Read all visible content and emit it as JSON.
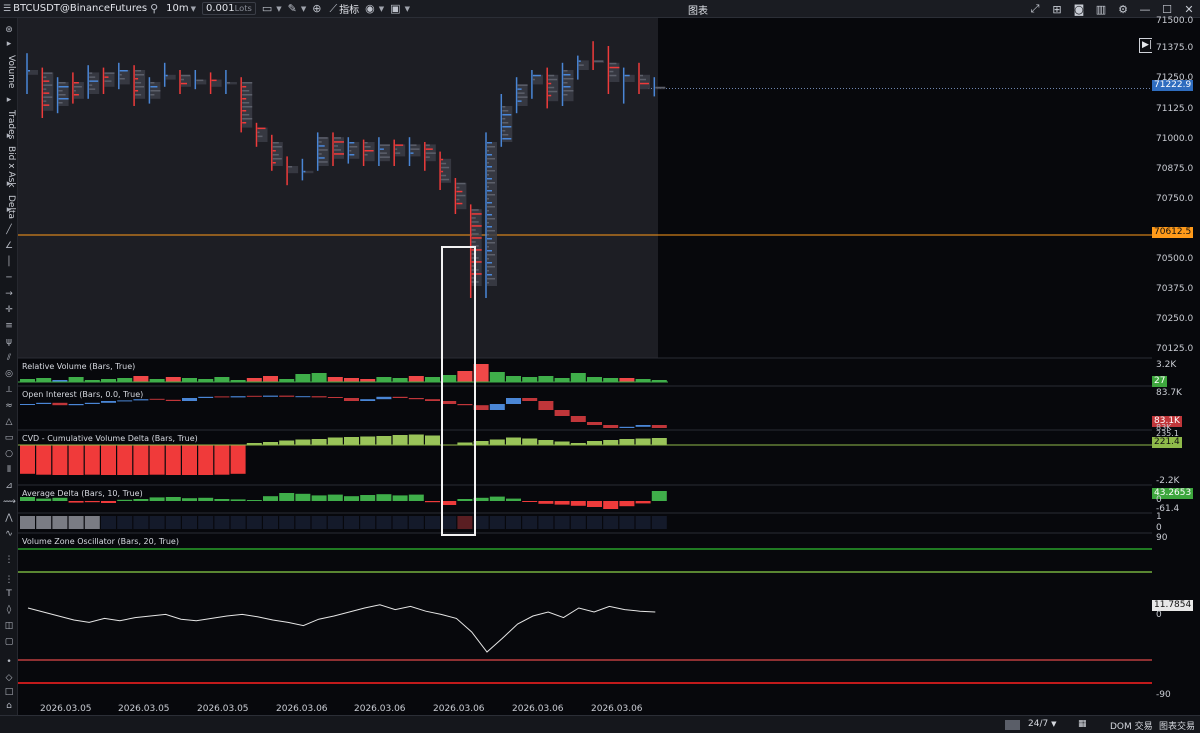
{
  "toolbar": {
    "symbol": "BTCUSDT@BinanceFutures",
    "interval": "10m",
    "lots_value": "0.001",
    "lots_unit": "Lots",
    "indicators_label": "指标",
    "window_title": "图表"
  },
  "left_tabs": [
    "Volume",
    "Trades",
    "Bid x Ask",
    "Delta"
  ],
  "price_axis": {
    "ticks": [
      "71500.0",
      "71375.0",
      "71250.0",
      "71125.0",
      "71000.0",
      "70875.0",
      "70750.0",
      "70625.0",
      "70500.0",
      "70375.0",
      "70250.0",
      "70125.0"
    ],
    "last_price": "71222.9",
    "line_price": "70612.5",
    "line_color": "#ff9a1a"
  },
  "panels": {
    "relative_volume": {
      "title": "Relative Volume (Bars, True)",
      "scale_top": "3.2K",
      "value": "27"
    },
    "open_interest": {
      "title": "Open Interest (Bars, 0.0, True)",
      "scale_top": "83.7K",
      "value": "83.1K",
      "scale_low": "83K"
    },
    "cvd": {
      "title": "CVD - Cumulative Volume Delta (Bars, True)",
      "value": "221.4",
      "value2": "235.1",
      "scale_low": "-2.2K"
    },
    "avg_delta": {
      "title": "Average Delta (Bars, 10, True)",
      "value": "43.2653",
      "scale_mid": "0",
      "scale_low": "-61.4"
    },
    "extra_scale": [
      "1",
      "0"
    ],
    "vzo": {
      "title": "Volume Zone Oscillator (Bars, 20, True)",
      "scale_top": "90",
      "value": "11.7854",
      "scale_mid": "0",
      "scale_low": "-90"
    }
  },
  "dates": [
    "2026.03.05",
    "2026.03.05",
    "2026.03.05",
    "2026.03.06",
    "2026.03.06",
    "2026.03.06",
    "2026.03.06",
    "2026.03.06"
  ],
  "bottom_bar": {
    "session": "24/7",
    "dom": "DOM 交易",
    "chart_trade": "图表交易"
  },
  "chart_data": {
    "type": "line",
    "candles": [
      {
        "o": 71300,
        "h": 71370,
        "l": 71200,
        "c": 71280,
        "dir": "up"
      },
      {
        "o": 71290,
        "h": 71310,
        "l": 71100,
        "c": 71130,
        "dir": "down"
      },
      {
        "o": 71150,
        "h": 71270,
        "l": 71120,
        "c": 71250,
        "dir": "up"
      },
      {
        "o": 71250,
        "h": 71290,
        "l": 71160,
        "c": 71180,
        "dir": "down"
      },
      {
        "o": 71200,
        "h": 71320,
        "l": 71180,
        "c": 71290,
        "dir": "up"
      },
      {
        "o": 71290,
        "h": 71310,
        "l": 71200,
        "c": 71230,
        "dir": "down"
      },
      {
        "o": 71240,
        "h": 71330,
        "l": 71220,
        "c": 71300,
        "dir": "up"
      },
      {
        "o": 71300,
        "h": 71320,
        "l": 71150,
        "c": 71180,
        "dir": "down"
      },
      {
        "o": 71180,
        "h": 71270,
        "l": 71160,
        "c": 71250,
        "dir": "up"
      },
      {
        "o": 71260,
        "h": 71330,
        "l": 71230,
        "c": 71280,
        "dir": "up"
      },
      {
        "o": 71280,
        "h": 71300,
        "l": 71200,
        "c": 71230,
        "dir": "down"
      },
      {
        "o": 71240,
        "h": 71300,
        "l": 71220,
        "c": 71260,
        "dir": "up"
      },
      {
        "o": 71260,
        "h": 71290,
        "l": 71200,
        "c": 71230,
        "dir": "down"
      },
      {
        "o": 71240,
        "h": 71300,
        "l": 71200,
        "c": 71250,
        "dir": "up"
      },
      {
        "o": 71250,
        "h": 71270,
        "l": 71040,
        "c": 71060,
        "dir": "down"
      },
      {
        "o": 71060,
        "h": 71080,
        "l": 70980,
        "c": 71000,
        "dir": "down"
      },
      {
        "o": 71000,
        "h": 71030,
        "l": 70880,
        "c": 70900,
        "dir": "down"
      },
      {
        "o": 70900,
        "h": 70940,
        "l": 70820,
        "c": 70870,
        "dir": "down"
      },
      {
        "o": 70870,
        "h": 70930,
        "l": 70840,
        "c": 70880,
        "dir": "up"
      },
      {
        "o": 70900,
        "h": 71040,
        "l": 70880,
        "c": 71020,
        "dir": "up"
      },
      {
        "o": 71020,
        "h": 71040,
        "l": 70900,
        "c": 70930,
        "dir": "down"
      },
      {
        "o": 70930,
        "h": 71020,
        "l": 70910,
        "c": 71000,
        "dir": "up"
      },
      {
        "o": 71000,
        "h": 71010,
        "l": 70900,
        "c": 70920,
        "dir": "down"
      },
      {
        "o": 70920,
        "h": 71020,
        "l": 70900,
        "c": 70990,
        "dir": "up"
      },
      {
        "o": 70990,
        "h": 71010,
        "l": 70900,
        "c": 70940,
        "dir": "down"
      },
      {
        "o": 70940,
        "h": 71020,
        "l": 70900,
        "c": 70990,
        "dir": "up"
      },
      {
        "o": 70990,
        "h": 71000,
        "l": 70880,
        "c": 70920,
        "dir": "down"
      },
      {
        "o": 70930,
        "h": 70960,
        "l": 70800,
        "c": 70830,
        "dir": "down"
      },
      {
        "o": 70830,
        "h": 70850,
        "l": 70700,
        "c": 70720,
        "dir": "down"
      },
      {
        "o": 70720,
        "h": 70740,
        "l": 70350,
        "c": 70400,
        "dir": "down"
      },
      {
        "o": 70400,
        "h": 71040,
        "l": 70350,
        "c": 71000,
        "dir": "up"
      },
      {
        "o": 71000,
        "h": 71200,
        "l": 70980,
        "c": 71150,
        "dir": "up"
      },
      {
        "o": 71150,
        "h": 71270,
        "l": 71120,
        "c": 71240,
        "dir": "up"
      },
      {
        "o": 71240,
        "h": 71300,
        "l": 71180,
        "c": 71280,
        "dir": "up"
      },
      {
        "o": 71280,
        "h": 71310,
        "l": 71140,
        "c": 71170,
        "dir": "down"
      },
      {
        "o": 71170,
        "h": 71330,
        "l": 71150,
        "c": 71300,
        "dir": "up"
      },
      {
        "o": 71300,
        "h": 71360,
        "l": 71260,
        "c": 71340,
        "dir": "up"
      },
      {
        "o": 71340,
        "h": 71420,
        "l": 71300,
        "c": 71330,
        "dir": "down"
      },
      {
        "o": 71330,
        "h": 71400,
        "l": 71200,
        "c": 71250,
        "dir": "down"
      },
      {
        "o": 71250,
        "h": 71310,
        "l": 71160,
        "c": 71280,
        "dir": "up"
      },
      {
        "o": 71280,
        "h": 71330,
        "l": 71200,
        "c": 71220,
        "dir": "down"
      },
      {
        "o": 71220,
        "h": 71270,
        "l": 71190,
        "c": 71230,
        "dir": "up"
      }
    ],
    "relative_volume": [
      3,
      4,
      2,
      5,
      2,
      3,
      4,
      6,
      3,
      5,
      4,
      3,
      5,
      2,
      4,
      6,
      3,
      8,
      9,
      5,
      4,
      3,
      5,
      4,
      6,
      5,
      7,
      11,
      18,
      10,
      6,
      5,
      6,
      4,
      9,
      5,
      4,
      4,
      3,
      2
    ],
    "relative_volume_colors": [
      "g",
      "g",
      "b",
      "g",
      "g",
      "g",
      "g",
      "r",
      "g",
      "r",
      "g",
      "g",
      "g",
      "g",
      "r",
      "r",
      "g",
      "g",
      "g",
      "r",
      "r",
      "r",
      "g",
      "g",
      "r",
      "g",
      "g",
      "r",
      "r",
      "g",
      "g",
      "g",
      "g",
      "g",
      "g",
      "g",
      "g",
      "r",
      "g",
      "g"
    ],
    "open_interest": [
      83.5,
      83.52,
      83.48,
      83.5,
      83.52,
      83.55,
      83.56,
      83.58,
      83.57,
      83.55,
      83.6,
      83.62,
      83.61,
      83.63,
      83.62,
      83.64,
      83.62,
      83.63,
      83.61,
      83.6,
      83.55,
      83.58,
      83.62,
      83.6,
      83.58,
      83.55,
      83.5,
      83.48,
      83.4,
      83.5,
      83.6,
      83.55,
      83.4,
      83.3,
      83.2,
      83.15,
      83.1,
      83.12,
      83.15,
      83.1
    ],
    "cvd": [
      -1600,
      -1650,
      -1700,
      -1700,
      -1650,
      -1700,
      -1750,
      -1700,
      -1650,
      -1700,
      -1750,
      -1700,
      -1650,
      -1600,
      30,
      60,
      90,
      110,
      120,
      150,
      160,
      170,
      180,
      200,
      210,
      190,
      -30,
      50,
      80,
      110,
      150,
      130,
      100,
      70,
      40,
      80,
      100,
      120,
      130,
      140
    ],
    "avg_delta": [
      10,
      6,
      8,
      -4,
      -3,
      -5,
      3,
      5,
      9,
      10,
      7,
      8,
      5,
      4,
      2,
      12,
      20,
      18,
      14,
      16,
      12,
      15,
      17,
      14,
      16,
      -3,
      -10,
      5,
      8,
      11,
      6,
      -2,
      -7,
      -9,
      -12,
      -15,
      -20,
      -13,
      -6,
      25
    ],
    "vzo": [
      10,
      5,
      0,
      -5,
      -8,
      -3,
      -6,
      -2,
      0,
      2,
      -4,
      -6,
      -3,
      0,
      2,
      -1,
      -5,
      -8,
      -12,
      -4,
      0,
      5,
      10,
      14,
      8,
      12,
      6,
      2,
      -3,
      -20,
      -45,
      -28,
      -10,
      0,
      5,
      -2,
      10,
      5,
      12,
      8,
      6,
      5
    ]
  }
}
